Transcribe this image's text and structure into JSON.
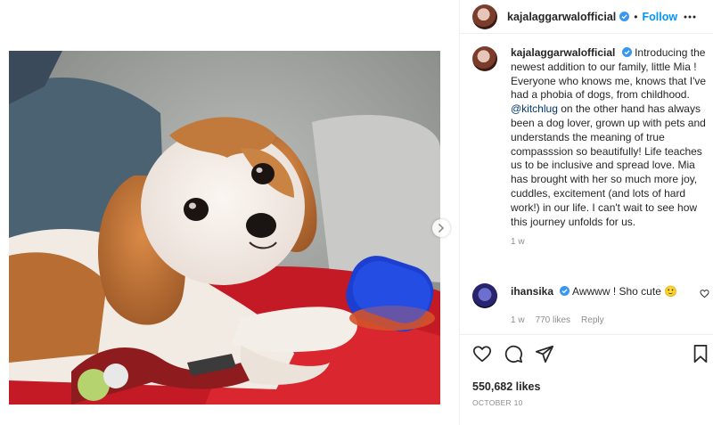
{
  "post": {
    "username": "kajalaggarwalofficial",
    "separator": "•",
    "follow_label": "Follow",
    "caption": {
      "username": "kajalaggarwalofficial",
      "text_part1": " Introducing the newest addition to our family, little Mia ! Everyone who knows me, knows that I've had a phobia of dogs, from childhood. ",
      "mention": "@kitchlug",
      "text_part2": " on the other hand has always been a dog lover, grown up with pets and understands the meaning of true compasssion so beautifully! Life teaches us to be inclusive and spread love. Mia has brought with her so much more joy, cuddles, excitement (and lots of hard work!) in our life. I can't wait to see how this journey unfolds for us.",
      "time": "1 w"
    },
    "comment": {
      "username": "ihansika",
      "text": " Awwww ! Sho cute ",
      "emoji": "🙂",
      "time": "1 w",
      "likes": "770 likes",
      "reply_label": "Reply"
    },
    "likes": "550,682 likes",
    "date": "OCTOBER 10"
  },
  "icons": {
    "verified": "verified-badge-icon",
    "more": "more-options-icon",
    "carousel": "chevron-right-icon",
    "like": "heart-icon",
    "comment": "comment-icon",
    "share": "paper-plane-icon",
    "save": "bookmark-icon"
  },
  "colors": {
    "accent": "#0095f6",
    "mention": "#00376b",
    "muted": "#8e8e8e",
    "text": "#262626"
  }
}
